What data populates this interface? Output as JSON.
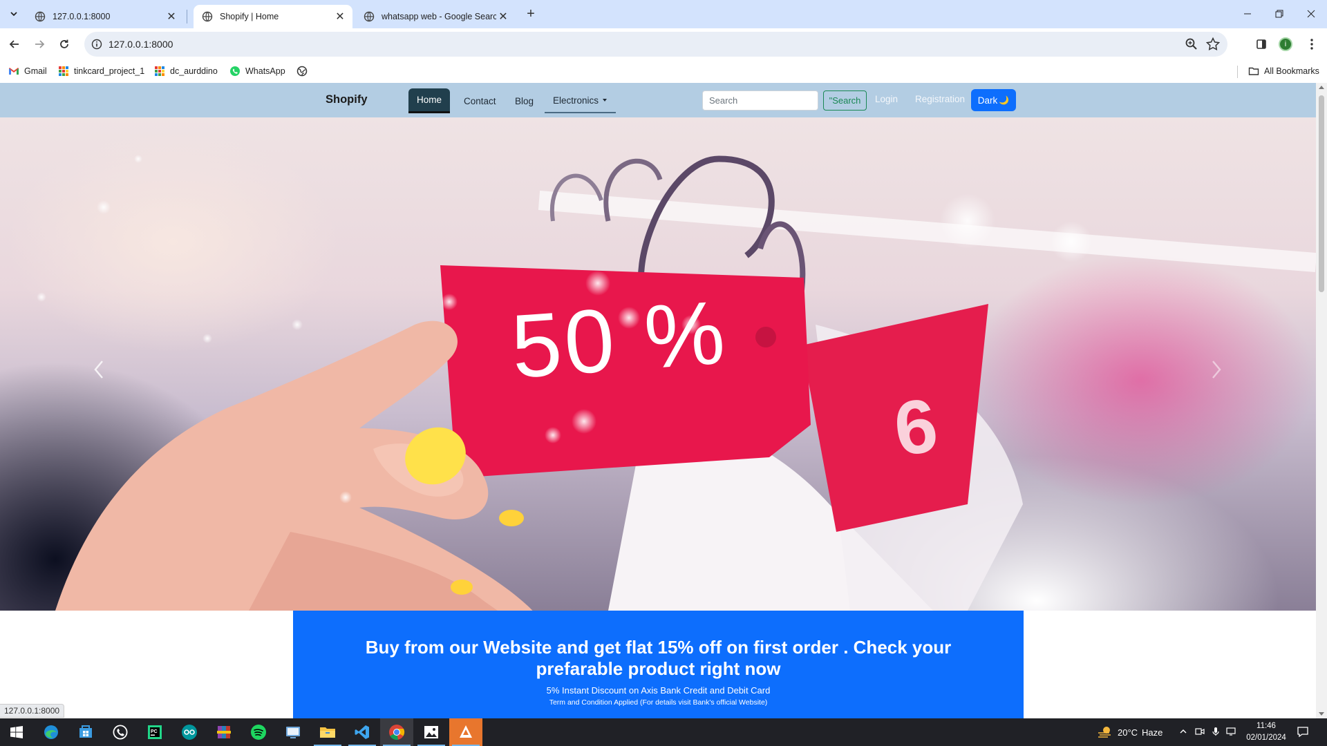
{
  "browser": {
    "tabs": [
      {
        "title": "127.0.0.1:8000",
        "active": false
      },
      {
        "title": "Shopify | Home",
        "active": true
      },
      {
        "title": "whatsapp web - Google Search",
        "active": false
      }
    ],
    "url": "127.0.0.1:8000",
    "bookmarks": [
      {
        "label": "Gmail",
        "icon": "gmail-icon"
      },
      {
        "label": "tinkcard_project_1",
        "icon": "grid-icon"
      },
      {
        "label": "dc_aurddino",
        "icon": "grid-icon"
      },
      {
        "label": "WhatsApp",
        "icon": "whatsapp-icon"
      }
    ],
    "all_bookmarks_label": "All Bookmarks",
    "profile_initial": "i",
    "status_url": "127.0.0.1:8000"
  },
  "site": {
    "brand": "Shopify",
    "nav": {
      "home": "Home",
      "contact": "Contact",
      "blog": "Blog",
      "electronics": "Electronics"
    },
    "search": {
      "placeholder": "Search",
      "button_label": "\"Search"
    },
    "login": "Login",
    "registration": "Registration",
    "dark_toggle": "Dark",
    "dark_icon": "🌙",
    "hero": {
      "tag_text": "50 %"
    },
    "promo": {
      "headline": "Buy from our Website and get flat 15% off on first order . Check your prefarable product right now",
      "offer": "5% Instant Discount on Axis Bank Credit and Debit Card",
      "terms": "Term and Condition Applied (For details visit Bank's official Website)"
    }
  },
  "taskbar": {
    "weather_temp": "20°C",
    "weather_desc": "Haze",
    "time": "11:46",
    "date": "02/01/2024"
  }
}
